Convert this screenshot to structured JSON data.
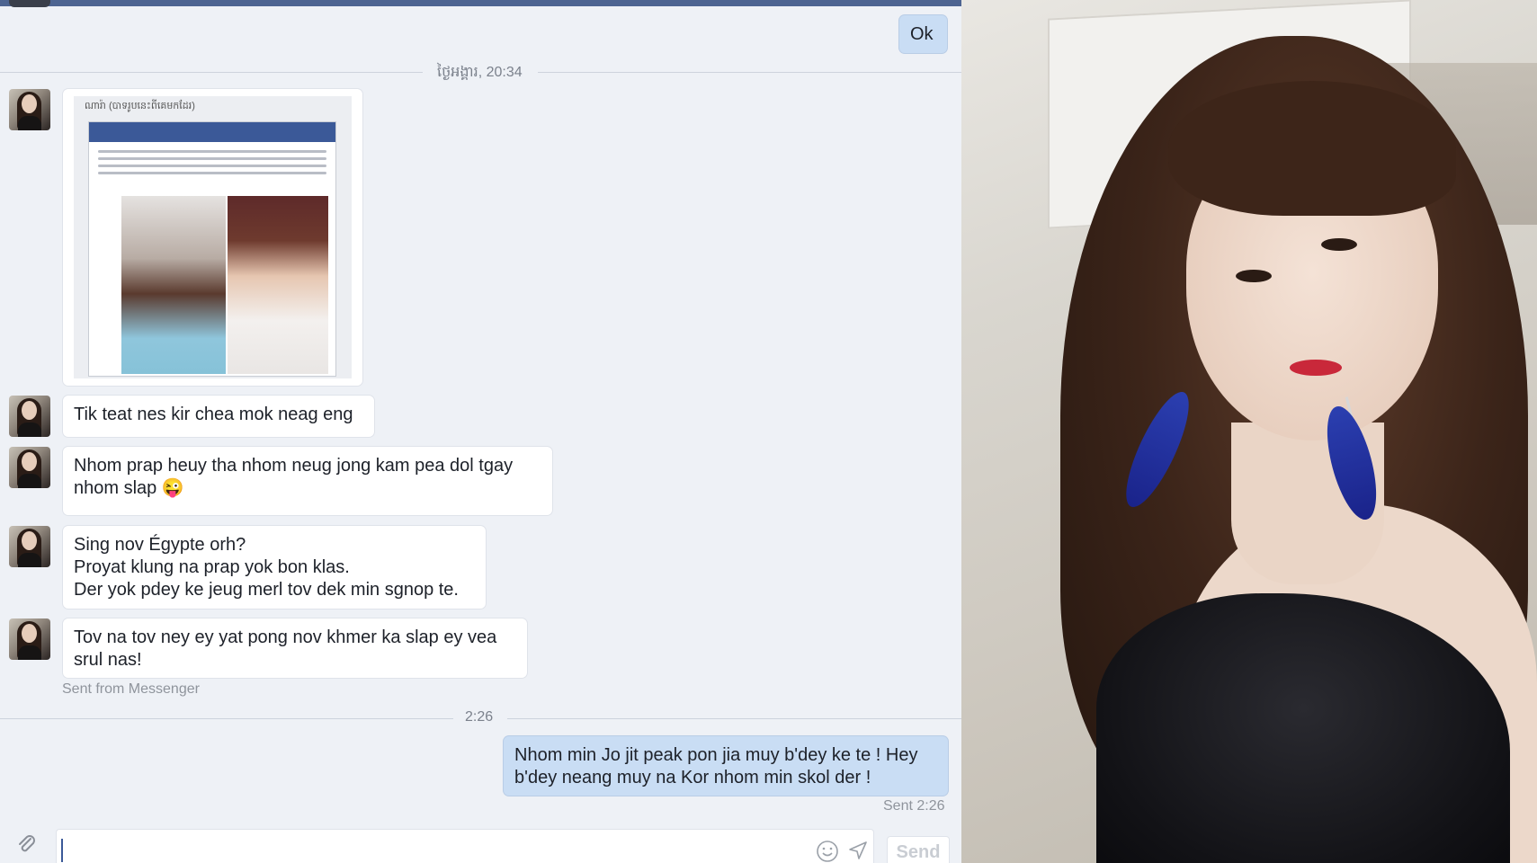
{
  "conversation": {
    "top_message": {
      "text": "Ok"
    },
    "divider_1": {
      "label": "ថ្ងៃអង្គារ, 20:34"
    },
    "shared_image": {
      "caption": "ណារ៉ា (បាទរូបនេះពីគេមកដែរ)"
    },
    "incoming": [
      {
        "lines": [
          "Tik teat nes kir chea mok neag eng"
        ]
      },
      {
        "lines": [
          "Nhom prap heuy tha nhom neug jong kam pea dol tgay",
          "nhom slap 😜"
        ]
      },
      {
        "lines": [
          "Sing nov Égypte orh?",
          "Proyat klung na prap yok bon klas.",
          "Der yok pdey ke jeug merl tov dek min sgnop te."
        ]
      },
      {
        "lines": [
          "Tov na tov ney ey yat pong nov khmer ka slap ey vea",
          "srul nas!"
        ]
      }
    ],
    "sent_from": "Sent from Messenger",
    "divider_2": {
      "label": "2:26"
    },
    "outgoing": {
      "lines": [
        "Nhom min Jo jit peak pon jia muy b'dey ke te ! Hey",
        "b'dey neang muy na Kor nhom min skol der !"
      ],
      "status": "Sent 2:26"
    }
  },
  "composer": {
    "value": "",
    "send_label": "Send",
    "icons": [
      "paperclip-icon",
      "emoji-icon",
      "send-arrow-icon"
    ]
  },
  "colors": {
    "top_bar": "#4d6491",
    "outgoing_bubble": "#c9ddf4",
    "background": "#eef1f6"
  }
}
